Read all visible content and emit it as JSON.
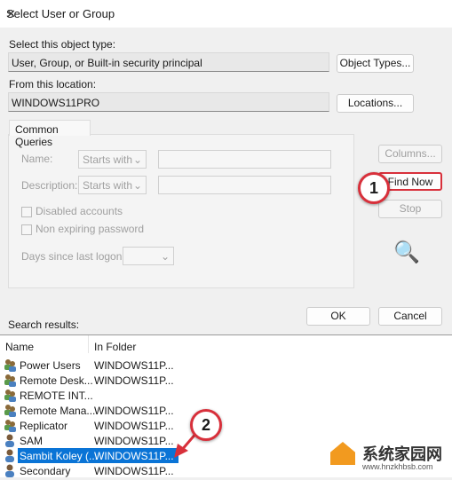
{
  "window": {
    "title": "Select User or Group",
    "close": "✕"
  },
  "object_type": {
    "label": "Select this object type:",
    "value": "User, Group, or Built-in security principal",
    "button": "Object Types..."
  },
  "location": {
    "label": "From this location:",
    "value": "WINDOWS11PRO",
    "button": "Locations..."
  },
  "queries": {
    "tab": "Common Queries",
    "name_label": "Name:",
    "name_combo": "Starts with",
    "desc_label": "Description:",
    "desc_combo": "Starts with",
    "disabled": "Disabled accounts",
    "nonexp": "Non expiring password",
    "days": "Days since last logon:"
  },
  "buttons": {
    "columns": "Columns...",
    "find": "Find Now",
    "stop": "Stop",
    "ok": "OK",
    "cancel": "Cancel"
  },
  "results": {
    "label": "Search results:",
    "columns": [
      "Name",
      "In Folder"
    ],
    "rows": [
      {
        "name": "Power Users",
        "folder": "WINDOWS11P...",
        "icon": "group"
      },
      {
        "name": "Remote Desk...",
        "folder": "WINDOWS11P...",
        "icon": "group"
      },
      {
        "name": "REMOTE INT...",
        "folder": "",
        "icon": "group"
      },
      {
        "name": "Remote Mana...",
        "folder": "WINDOWS11P...",
        "icon": "group"
      },
      {
        "name": "Replicator",
        "folder": "WINDOWS11P...",
        "icon": "group"
      },
      {
        "name": "SAM",
        "folder": "WINDOWS11P...",
        "icon": "user"
      },
      {
        "name": "Sambit Koley (...",
        "folder": "WINDOWS11P...",
        "icon": "user",
        "selected": true
      },
      {
        "name": "Secondary",
        "folder": "WINDOWS11P...",
        "icon": "user"
      }
    ]
  },
  "annotations": {
    "one": "1",
    "two": "2",
    "color": "#d8303b"
  },
  "watermark": {
    "text": "系统家园网",
    "url": "www.hnzkhbsb.com"
  }
}
